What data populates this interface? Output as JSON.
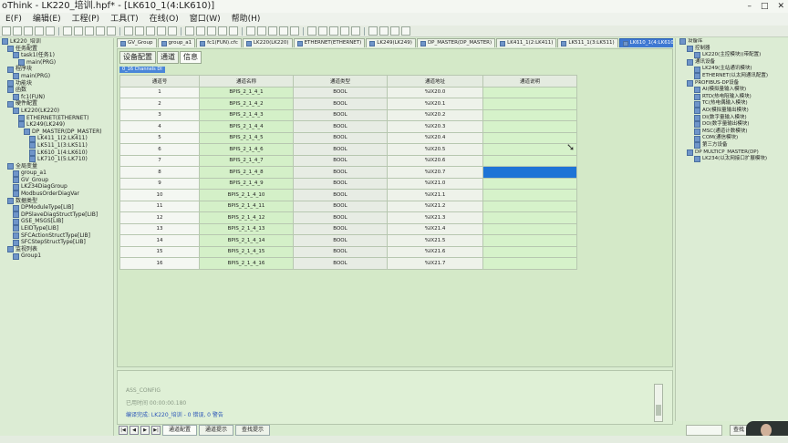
{
  "window": {
    "title": "oThink - LK220_培训.hpf* - [LK610_1(4:LK610)]",
    "controls": [
      "–",
      "□",
      "✕"
    ]
  },
  "menu": [
    "E(F)",
    "编辑(E)",
    "工程(P)",
    "工具(T)",
    "在线(O)",
    "窗口(W)",
    "帮助(H)"
  ],
  "left_tree": [
    {
      "indent": 0,
      "label": "LK220_培训"
    },
    {
      "indent": 1,
      "label": "任务配置"
    },
    {
      "indent": 2,
      "label": "task1(任务1)"
    },
    {
      "indent": 3,
      "label": "main(PRG)"
    },
    {
      "indent": 1,
      "label": "程序块"
    },
    {
      "indent": 2,
      "label": "main(PRG)"
    },
    {
      "indent": 1,
      "label": "功能块"
    },
    {
      "indent": 1,
      "label": "函数"
    },
    {
      "indent": 2,
      "label": "fc1(FUN)"
    },
    {
      "indent": 1,
      "label": "硬件配置"
    },
    {
      "indent": 2,
      "label": "LK220(LK220)"
    },
    {
      "indent": 3,
      "label": "ETHERNET(ETHERNET)"
    },
    {
      "indent": 3,
      "label": "LK249(LK249)"
    },
    {
      "indent": 4,
      "label": "DP_MASTER(DP_MASTER)"
    },
    {
      "indent": 5,
      "label": "LK411_1(2:LK411)"
    },
    {
      "indent": 5,
      "label": "LK511_1(3:LK511)"
    },
    {
      "indent": 5,
      "label": "LK610_1(4:LK610)"
    },
    {
      "indent": 5,
      "label": "LK710_1(5:LK710)"
    },
    {
      "indent": 1,
      "label": ""
    },
    {
      "indent": 1,
      "label": "全局变量"
    },
    {
      "indent": 2,
      "label": "group_a1"
    },
    {
      "indent": 2,
      "label": "GV_Group"
    },
    {
      "indent": 2,
      "label": "LK234DiagGroup"
    },
    {
      "indent": 2,
      "label": "ModbusOrderDiagVar"
    },
    {
      "indent": 1,
      "label": "数据类型"
    },
    {
      "indent": 2,
      "label": "DPModuleType[LIB]"
    },
    {
      "indent": 2,
      "label": "DPSlaveDiagStructType[LIB]"
    },
    {
      "indent": 2,
      "label": "GSE_MSGS[LIB]"
    },
    {
      "indent": 2,
      "label": "LEIDType[LIB]"
    },
    {
      "indent": 2,
      "label": "SFCActionStructType[LIB]"
    },
    {
      "indent": 2,
      "label": "SFCStepStructType[LIB]"
    },
    {
      "indent": 1,
      "label": "监视列表"
    },
    {
      "indent": 2,
      "label": "Group1"
    }
  ],
  "editor_tabs": [
    {
      "label": "GV_Group",
      "active": false
    },
    {
      "label": "group_a1",
      "active": false
    },
    {
      "label": "fc1(FUN).cfc",
      "active": false
    },
    {
      "label": "LK220(LK220)",
      "active": false
    },
    {
      "label": "ETHERNET(ETHERNET)",
      "active": false
    },
    {
      "label": "LK249(LK249)",
      "active": false
    },
    {
      "label": "DP_MASTER(DP_MASTER)",
      "active": false
    },
    {
      "label": "LK411_1(2:LK411)",
      "active": false
    },
    {
      "label": "LK511_1(3:LK511)",
      "active": false
    },
    {
      "label": "LK610_1(4:LK610)",
      "active": true
    }
  ],
  "sub_tabs": [
    {
      "label": "设备配置",
      "active": false
    },
    {
      "label": "通道",
      "active": false
    },
    {
      "label": "信息",
      "active": true
    }
  ],
  "channel_header": "0_16 Channels DI",
  "table": {
    "columns": [
      "通道号",
      "通道名称",
      "通道类型",
      "通道地址",
      "通道说明"
    ],
    "rows": [
      [
        "1",
        "BPIS_2_1_4_1",
        "BOOL",
        "%IX20.0",
        ""
      ],
      [
        "2",
        "BPIS_2_1_4_2",
        "BOOL",
        "%IX20.1",
        ""
      ],
      [
        "3",
        "BPIS_2_1_4_3",
        "BOOL",
        "%IX20.2",
        ""
      ],
      [
        "4",
        "BPIS_2_1_4_4",
        "BOOL",
        "%IX20.3",
        ""
      ],
      [
        "5",
        "BPIS_2_1_4_5",
        "BOOL",
        "%IX20.4",
        ""
      ],
      [
        "6",
        "BPIS_2_1_4_6",
        "BOOL",
        "%IX20.5",
        ""
      ],
      [
        "7",
        "BPIS_2_1_4_7",
        "BOOL",
        "%IX20.6",
        ""
      ],
      [
        "8",
        "BPIS_2_1_4_8",
        "BOOL",
        "%IX20.7",
        ""
      ],
      [
        "9",
        "BPIS_2_1_4_9",
        "BOOL",
        "%IX21.0",
        ""
      ],
      [
        "10",
        "BPIS_2_1_4_10",
        "BOOL",
        "%IX21.1",
        ""
      ],
      [
        "11",
        "BPIS_2_1_4_11",
        "BOOL",
        "%IX21.2",
        ""
      ],
      [
        "12",
        "BPIS_2_1_4_12",
        "BOOL",
        "%IX21.3",
        ""
      ],
      [
        "13",
        "BPIS_2_1_4_13",
        "BOOL",
        "%IX21.4",
        ""
      ],
      [
        "14",
        "BPIS_2_1_4_14",
        "BOOL",
        "%IX21.5",
        ""
      ],
      [
        "15",
        "BPIS_2_1_4_15",
        "BOOL",
        "%IX21.6",
        ""
      ],
      [
        "16",
        "BPIS_2_1_4_16",
        "BOOL",
        "%IX21.7",
        ""
      ]
    ],
    "selected_row": 8
  },
  "output": {
    "lines": [
      "ASS_CONFIG",
      "已用时间 00:00:00.180",
      "编译完成: LK220_培训 - 0 错误, 0 警告"
    ]
  },
  "bottom_tabs": [
    {
      "label": "通道配置",
      "active": true
    },
    {
      "label": "通道提示",
      "active": false
    },
    {
      "label": "查找提示",
      "active": false
    }
  ],
  "right_tree": [
    {
      "indent": 0,
      "label": "设备库"
    },
    {
      "indent": 1,
      "label": "控制器"
    },
    {
      "indent": 2,
      "label": "LK220(主控模块)(带配置)"
    },
    {
      "indent": 1,
      "label": "通讯设备"
    },
    {
      "indent": 2,
      "label": "LK249(主站通讯模块)"
    },
    {
      "indent": 2,
      "label": "ETHERNET(以太网通讯配置)"
    },
    {
      "indent": 1,
      "label": "PROFIBUS-DP设备"
    },
    {
      "indent": 2,
      "label": "AI(模拟量输入模块)"
    },
    {
      "indent": 2,
      "label": "RTD(热电阻输入模块)"
    },
    {
      "indent": 2,
      "label": "TC(热电偶输入模块)"
    },
    {
      "indent": 2,
      "label": "AO(模拟量输出模块)"
    },
    {
      "indent": 2,
      "label": "DI(数字量输入模块)"
    },
    {
      "indent": 2,
      "label": "DO(数字量输出模块)"
    },
    {
      "indent": 2,
      "label": "MSC(通道计数模块)"
    },
    {
      "indent": 2,
      "label": "COM(通信模块)"
    },
    {
      "indent": 2,
      "label": "第三方设备"
    },
    {
      "indent": 1,
      "label": "DP MULTICP_MASTER(DP)"
    },
    {
      "indent": 2,
      "label": "LK234(以太网接口扩展模块)"
    }
  ],
  "right_button": "查找"
}
